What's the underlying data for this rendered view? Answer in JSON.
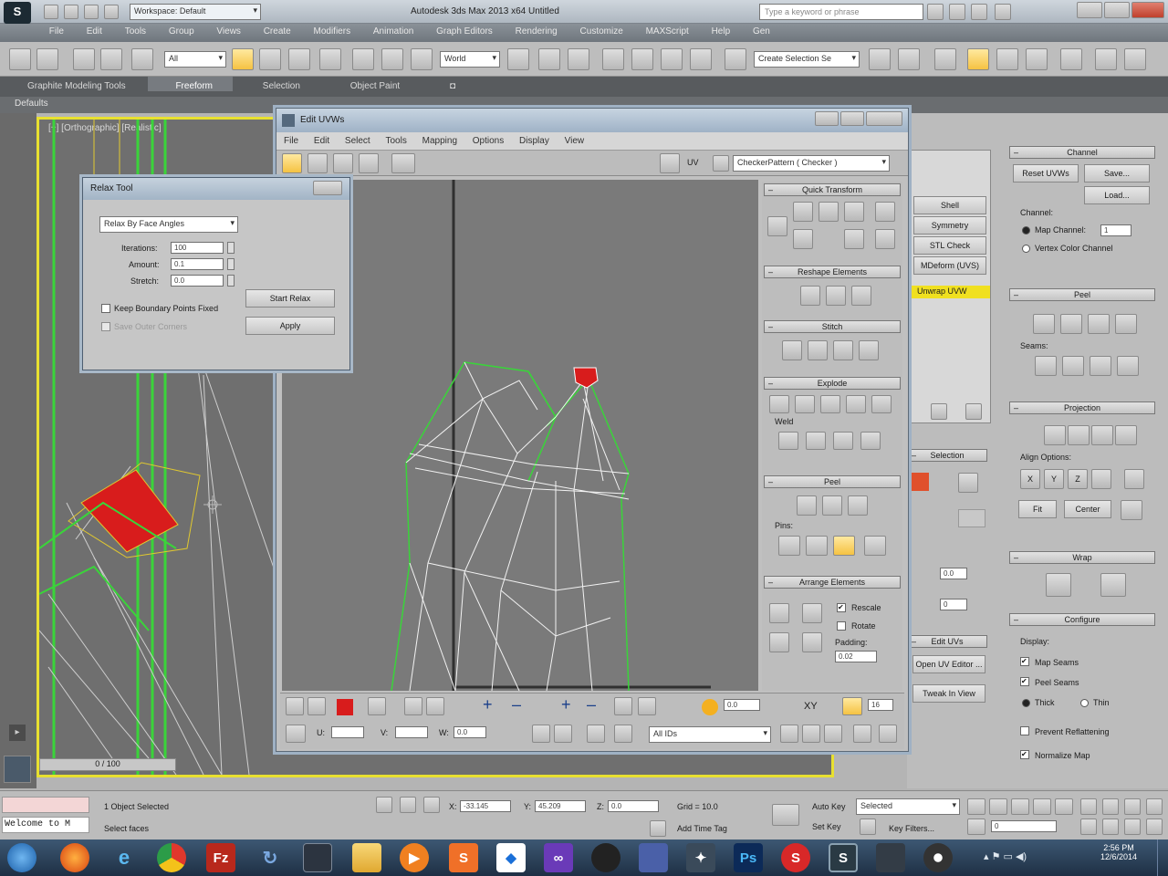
{
  "app": {
    "title": "Autodesk 3ds Max 2013 x64     Untitled",
    "workspace": "Workspace: Default",
    "search_placeholder": "Type a keyword or phrase"
  },
  "menu": [
    "File",
    "Edit",
    "Tools",
    "Group",
    "Views",
    "Create",
    "Modifiers",
    "Animation",
    "Graph Editors",
    "Rendering",
    "Customize",
    "MAXScript",
    "Help",
    "Gen"
  ],
  "toolbar": {
    "filter_value": "All",
    "coord_value": "World",
    "selection_set": "Create Selection Se"
  },
  "ribbon": {
    "tabs": [
      "Graphite Modeling Tools",
      "Freeform",
      "Selection",
      "Object Paint"
    ],
    "sub": "Defaults"
  },
  "viewport": {
    "label": "[+] [Orthographic] [Realistic]",
    "frame_counter": "0 / 100"
  },
  "uv_editor": {
    "title": "Edit UVWs",
    "menu": [
      "File",
      "Edit",
      "Select",
      "Tools",
      "Mapping",
      "Options",
      "Display",
      "View"
    ],
    "uv_label": "UV",
    "texture_combo": "CheckerPattern  ( Checker )",
    "rollouts": [
      "Quick Transform",
      "Reshape Elements",
      "Stitch",
      "Explode",
      "Peel",
      "Arrange Elements"
    ],
    "weld_label": "Weld",
    "pins_label": "Pins:",
    "rescale": "Rescale",
    "rotate": "Rotate",
    "padding_label": "Padding:",
    "padding_value": "0.02",
    "bottom": {
      "u_label": "U:",
      "v_label": "V:",
      "w_label": "W:",
      "w_value": "0.0",
      "xy": "XY",
      "spin_value": "0.0",
      "spin_value2": "16",
      "all_ids": "All IDs"
    }
  },
  "relax": {
    "title": "Relax Tool",
    "mode": "Relax By Face Angles",
    "iterations_label": "Iterations:",
    "iterations_value": "100",
    "amount_label": "Amount:",
    "amount_value": "0.1",
    "stretch_label": "Stretch:",
    "stretch_value": "0.0",
    "keep_boundary": "Keep Boundary Points Fixed",
    "save_outer": "Save Outer Corners",
    "start_relax": "Start Relax",
    "apply": "Apply"
  },
  "modifier_stack": {
    "items": [
      "Shell",
      "Symmetry",
      "STL Check",
      "MDeform (UVS)"
    ],
    "active": "Unwrap UVW",
    "sections": [
      "Selection",
      "Edit UVs"
    ],
    "open_editor": "Open UV Editor ...",
    "tweak": "Tweak In View",
    "spin1": "0.0",
    "spin2": "0"
  },
  "cmdpanel": {
    "channel_title": "Channel",
    "reset_uvws": "Reset UVWs",
    "save": "Save...",
    "load": "Load...",
    "channel_label": "Channel:",
    "map_channel": "Map Channel:",
    "map_channel_value": "1",
    "vertex_color_channel": "Vertex Color Channel",
    "peel_title": "Peel",
    "seams_label": "Seams:",
    "projection_title": "Projection",
    "align_options": "Align Options:",
    "fit": "Fit",
    "center": "Center",
    "wrap_title": "Wrap",
    "configure_title": "Configure",
    "display_label": "Display:",
    "map_seams": "Map Seams",
    "peel_seams": "Peel Seams",
    "thick": "Thick",
    "thin": "Thin",
    "prevent_reflattening": "Prevent Reflattening",
    "normalize_map": "Normalize Map",
    "axis_buttons": [
      "X",
      "Y",
      "Z"
    ]
  },
  "status": {
    "selected": "1 Object Selected",
    "prompt": "Select faces",
    "listener": "Welcome to M",
    "x_label": "X:",
    "x_value": "-33.145",
    "y_label": "Y:",
    "y_value": "45.209",
    "z_label": "Z:",
    "z_value": "0.0",
    "grid": "Grid = 10.0",
    "add_time_tag": "Add Time Tag",
    "auto_key": "Auto Key",
    "set_key": "Set Key",
    "selected_combo": "Selected",
    "key_filters": "Key Filters...",
    "frame": "0"
  },
  "taskbar": {
    "icons": [
      "start-orb",
      "firefox",
      "internet-explorer",
      "chrome",
      "filezilla",
      "refresh-app",
      "media-app",
      "folder",
      "media-player",
      "sublime",
      "dropbox",
      "vs",
      "character-app",
      "unknown-app",
      "cad-app",
      "photoshop",
      "app-red",
      "3dsmax",
      "app-dark",
      "app-disc"
    ],
    "time": "2:56 PM",
    "date": "12/6/2014"
  },
  "colors": {
    "viewport_border": "#e8e030",
    "selection_red": "#d81c1c",
    "uv_wire": "#f2f2f2",
    "uv_edge_green": "#3ad43a"
  }
}
